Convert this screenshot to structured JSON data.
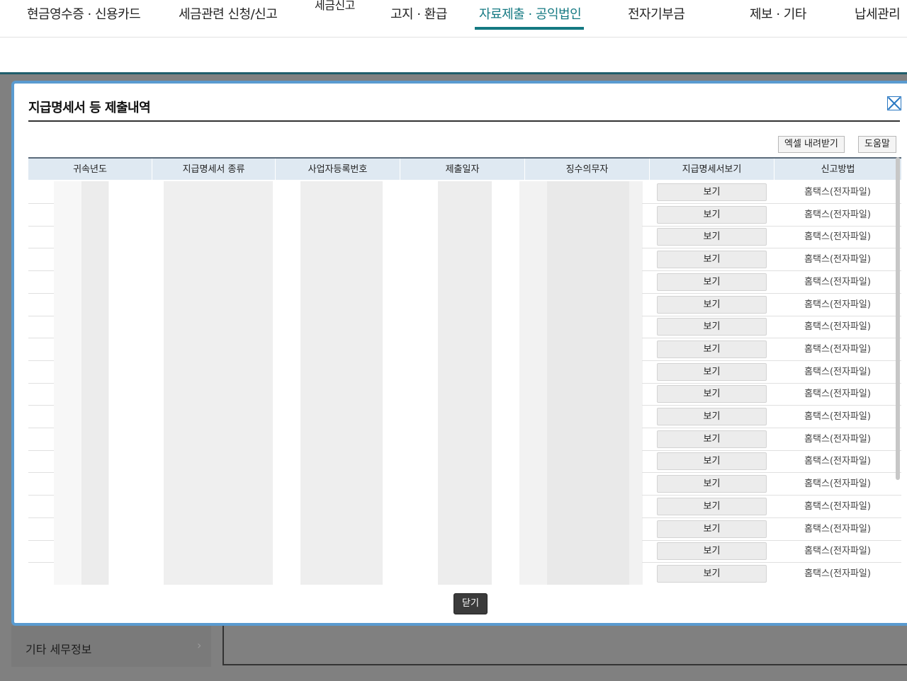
{
  "nav": {
    "items": [
      {
        "label": "현금영수증 · 신용카드"
      },
      {
        "label": "세금관련 신청/신고"
      },
      {
        "label": "세금신고"
      },
      {
        "label": "고지 · 환급"
      },
      {
        "label": "자료제출 · 공익법인"
      },
      {
        "label": "전자기부금"
      },
      {
        "label": "제보 · 기타"
      },
      {
        "label": "납세관리"
      }
    ],
    "active_index": 4
  },
  "sidebar": {
    "item_label": "기타 세무정보"
  },
  "modal": {
    "title": "지급명세서 등 제출내역",
    "excel_button": "엑셀 내려받기",
    "help_button": "도움말",
    "close_button": "닫기",
    "columns": [
      "귀속년도",
      "지급명세서 종류",
      "사업자등록번호",
      "제출일자",
      "징수의무자",
      "지급명세서보기",
      "신고방법"
    ],
    "rows": [
      {
        "view": "보기",
        "method": "홈택스(전자파일)"
      },
      {
        "view": "보기",
        "method": "홈택스(전자파일)"
      },
      {
        "view": "보기",
        "method": "홈택스(전자파일)"
      },
      {
        "view": "보기",
        "method": "홈택스(전자파일)"
      },
      {
        "view": "보기",
        "method": "홈택스(전자파일)"
      },
      {
        "view": "보기",
        "method": "홈택스(전자파일)"
      },
      {
        "view": "보기",
        "method": "홈택스(전자파일)"
      },
      {
        "view": "보기",
        "method": "홈택스(전자파일)"
      },
      {
        "view": "보기",
        "method": "홈택스(전자파일)"
      },
      {
        "view": "보기",
        "method": "홈택스(전자파일)"
      },
      {
        "view": "보기",
        "method": "홈택스(전자파일)"
      },
      {
        "view": "보기",
        "method": "홈택스(전자파일)"
      },
      {
        "view": "보기",
        "method": "홈택스(전자파일)"
      },
      {
        "view": "보기",
        "method": "홈택스(전자파일)"
      },
      {
        "view": "보기",
        "method": "홈택스(전자파일)"
      },
      {
        "view": "보기",
        "method": "홈택스(전자파일)"
      },
      {
        "view": "보기",
        "method": "홈택스(전자파일)"
      },
      {
        "view": "보기",
        "method": "홈택스(전자파일)"
      }
    ]
  },
  "colors": {
    "accent": "#147982",
    "modal_border": "#5a9bd0",
    "header_bg": "#dfe9f2"
  }
}
